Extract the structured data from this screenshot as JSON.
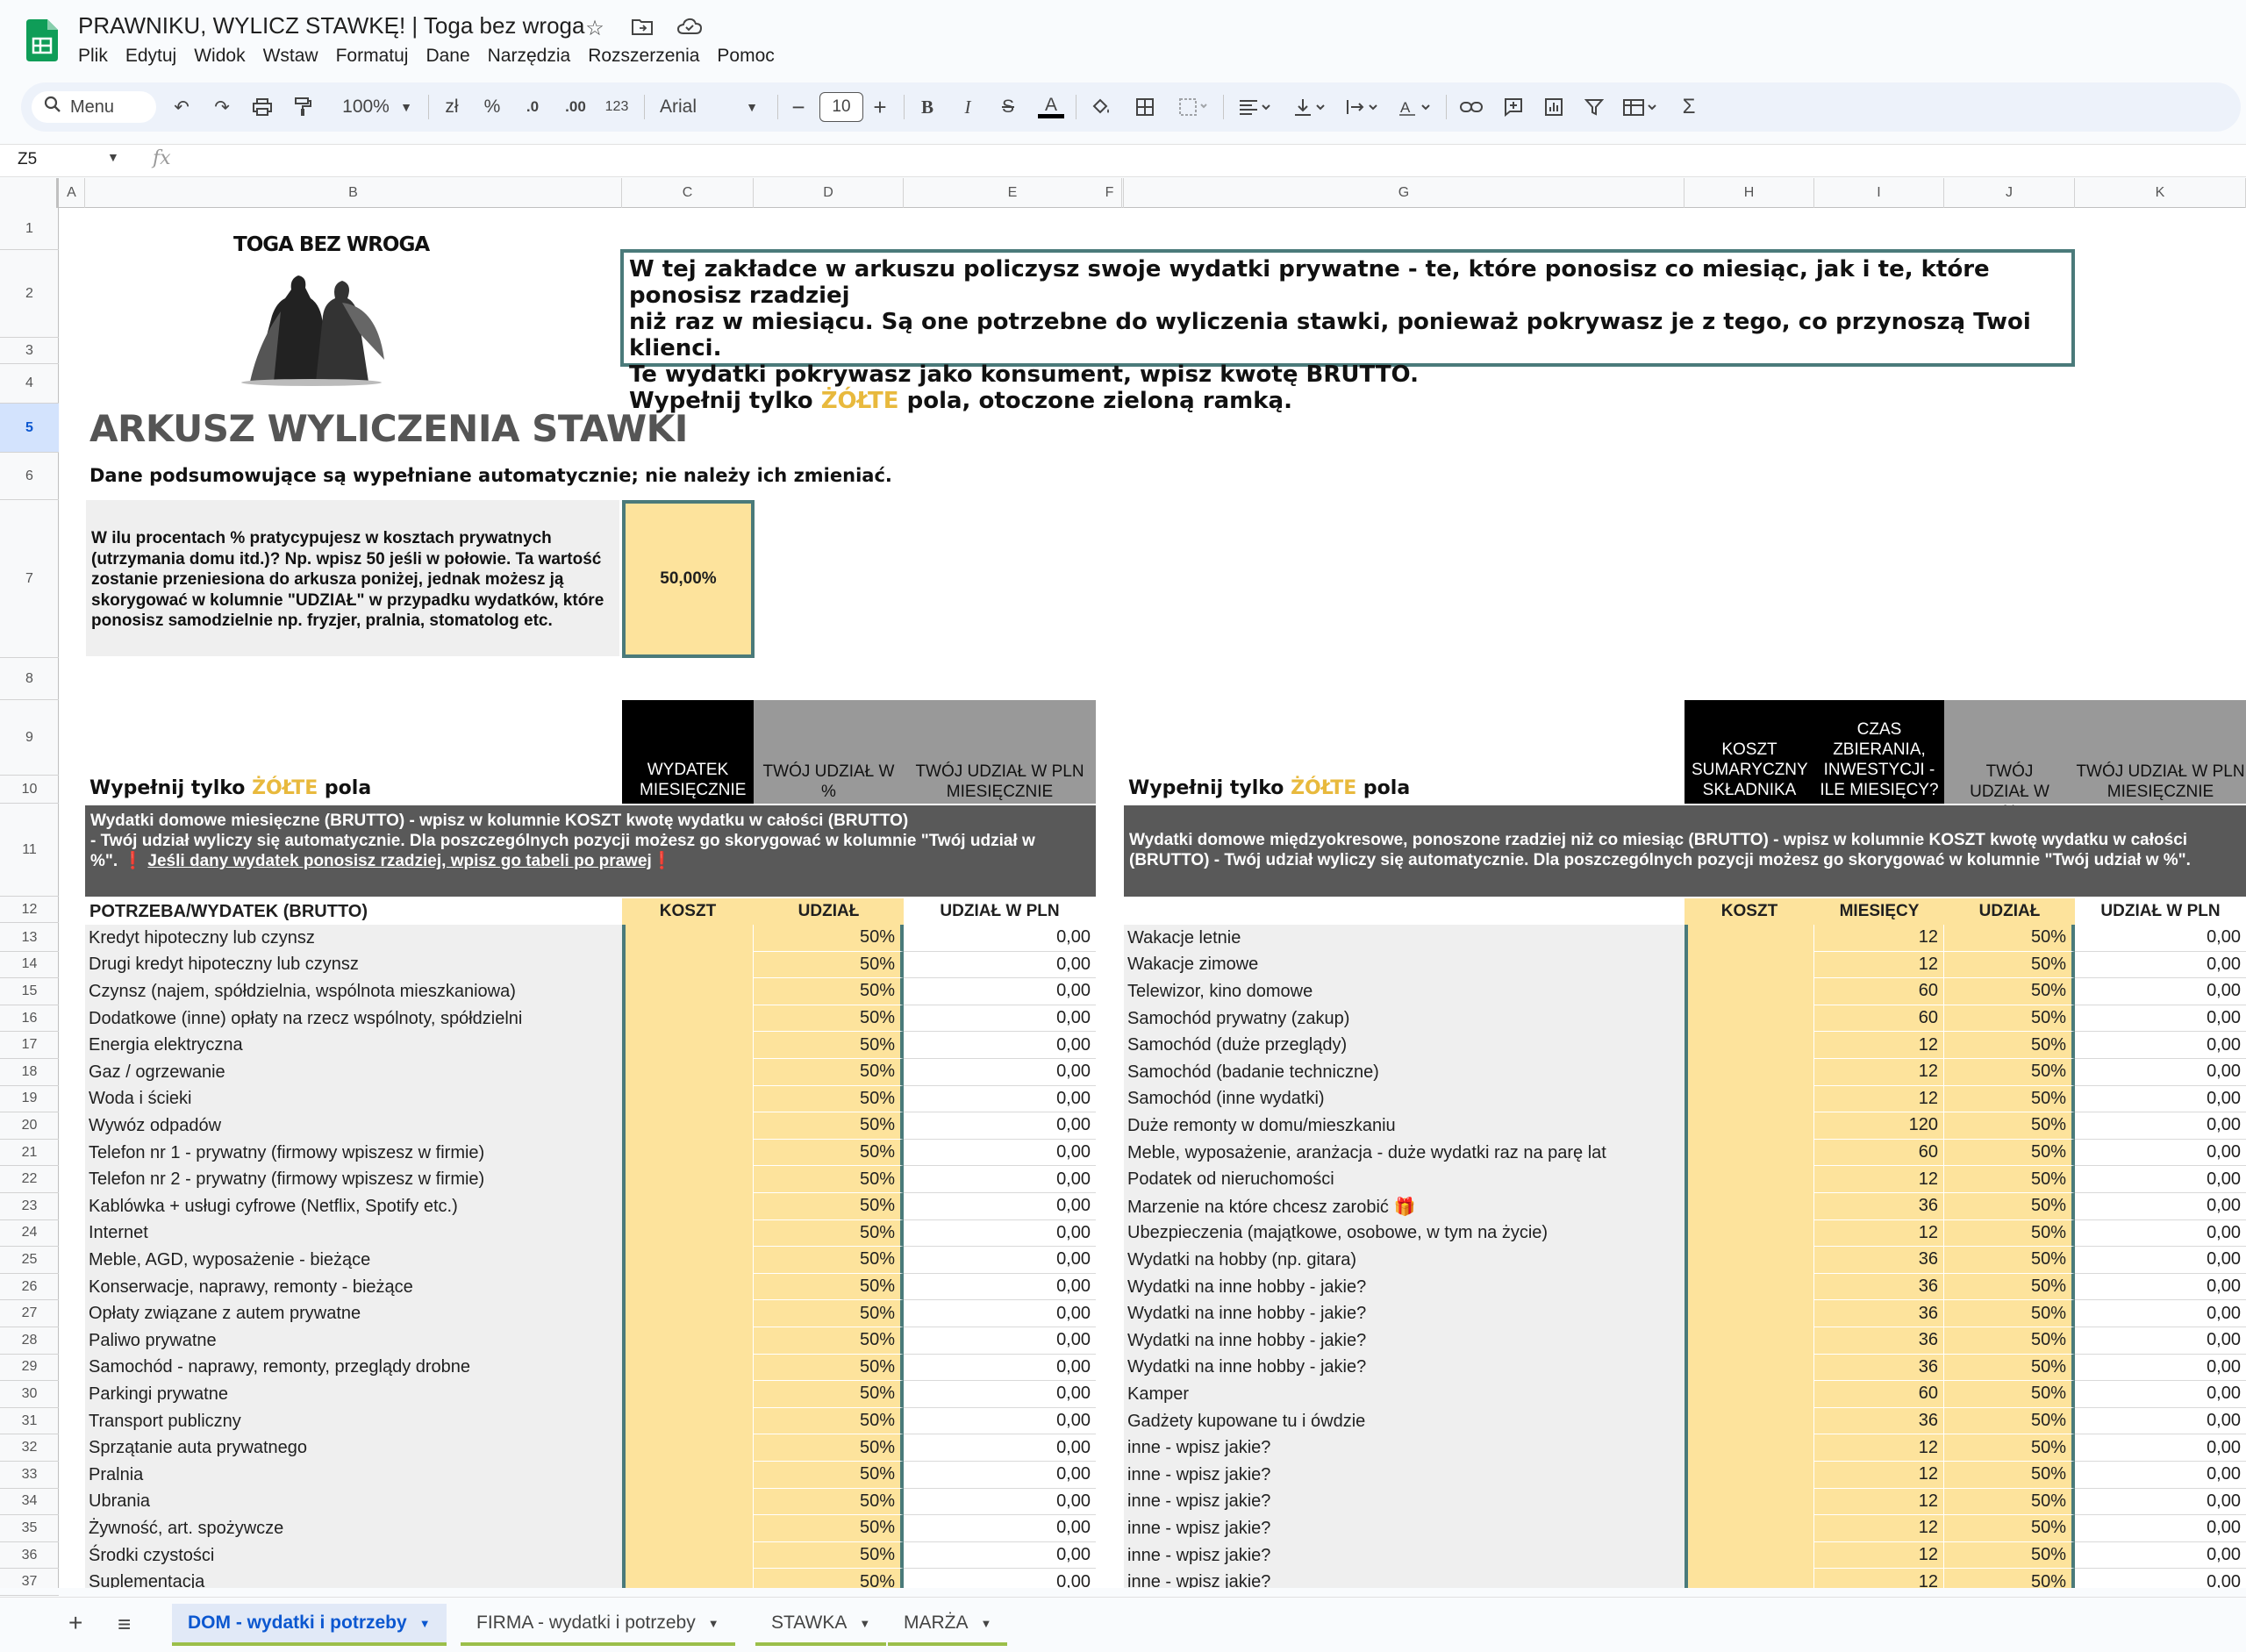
{
  "header": {
    "title": "PRAWNIKU, WYLICZ STAWKĘ! | Toga bez wroga",
    "menu": [
      "Plik",
      "Edytuj",
      "Widok",
      "Wstaw",
      "Formatuj",
      "Dane",
      "Narzędzia",
      "Rozszerzenia",
      "Pomoc"
    ]
  },
  "toolbar": {
    "menu_label": "Menu",
    "zoom": "100%",
    "currency": "zł",
    "percent": "%",
    "dec_decrease": ".0",
    "dec_increase": ".00",
    "format_123": "123",
    "font": "Arial",
    "font_size": "10"
  },
  "formula_bar": {
    "cell_ref": "Z5",
    "fx": "fx"
  },
  "columns": [
    "A",
    "B",
    "C",
    "D",
    "E",
    "F",
    "G",
    "H",
    "I",
    "J",
    "K"
  ],
  "rows": [
    "1",
    "2",
    "3",
    "4",
    "5",
    "6",
    "7",
    "8",
    "9",
    "10",
    "11",
    "12",
    "13",
    "14",
    "15",
    "16",
    "17",
    "18",
    "19",
    "20",
    "21",
    "22",
    "23",
    "24",
    "25",
    "26",
    "27",
    "28",
    "29",
    "30",
    "31",
    "32",
    "33",
    "34",
    "35",
    "36",
    "37"
  ],
  "sheet": {
    "logo_text": "TOGA BEZ WROGA",
    "info_line1": "W tej zakładce w arkuszu policzysz swoje wydatki prywatne - te, które ponosisz co miesiąc, jak i te, które ponosisz rzadziej",
    "info_line2": "niż raz w miesiącu. Są one potrzebne do wyliczenia stawki, ponieważ pokrywasz je z tego, co przynoszą Twoi klienci.",
    "info_line3": "Te wydatki pokrywasz jako konsument, wpisz kwotę BRUTTO.",
    "info_line4_pre": "Wypełnij tylko ",
    "info_line4_yellow": "ŻÓŁTE",
    "info_line4_post": " pola, otoczone zieloną ramką.",
    "title": "ARKUSZ WYLICZENIA STAWKI",
    "summary_note": "Dane podsumowujące są wypełniane automatycznie; nie należy ich zmieniać.",
    "question": "W ilu procentach % pratycypujesz w kosztach prywatnych (utrzymania domu itd.)? Np. wpisz 50 jeśli w połowie. Ta wartość zostanie przeniesiona do arkusza poniżej, jednak możesz ją skorygować w kolumnie \"UDZIAŁ\" w przypadku wydatków, które ponosisz samodzielnie np. fryzjer, pralnia, stomatolog etc.",
    "question_value": "50,00%",
    "fill_pre": "Wypełnij tylko ",
    "fill_yellow": "ŻÓŁTE",
    "fill_post": " pola"
  },
  "left_table": {
    "hdr_expense": "WYDATEK MIESIĘCZNIE",
    "hdr_share_pct": "TWÓJ UDZIAŁ W %",
    "hdr_share_pln": "TWÓJ UDZIAŁ W PLN MIESIĘCZNIE",
    "band_line1": "Wydatki domowe miesięczne (BRUTTO) - wpisz w kolumnie KOSZT kwotę wydatku w całości (BRUTTO)",
    "band_line2": "- Twój udział wyliczy się automatycznie. Dla poszczególnych pozycji możesz go skorygować w kolumnie \"Twój udział w",
    "band_line3_pre": "%\". ",
    "band_line3_link": "Jeśli dany wydatek ponosisz rzadziej, wpisz go tabeli po prawej",
    "col_name": "POTRZEBA/WYDATEK (BRUTTO)",
    "col_cost": "KOSZT",
    "col_share": "UDZIAŁ",
    "col_pln": "UDZIAŁ W PLN",
    "rows": [
      {
        "name": "Kredyt hipoteczny lub czynsz",
        "share": "50%",
        "pln": "0,00"
      },
      {
        "name": "Drugi kredyt hipoteczny lub czynsz",
        "share": "50%",
        "pln": "0,00"
      },
      {
        "name": "Czynsz (najem, spółdzielnia, wspólnota mieszkaniowa)",
        "share": "50%",
        "pln": "0,00"
      },
      {
        "name": "Dodatkowe (inne) opłaty na rzecz wspólnoty, spółdzielni",
        "share": "50%",
        "pln": "0,00"
      },
      {
        "name": "Energia elektryczna",
        "share": "50%",
        "pln": "0,00"
      },
      {
        "name": "Gaz / ogrzewanie",
        "share": "50%",
        "pln": "0,00"
      },
      {
        "name": "Woda i ścieki",
        "share": "50%",
        "pln": "0,00"
      },
      {
        "name": "Wywóz odpadów",
        "share": "50%",
        "pln": "0,00"
      },
      {
        "name": "Telefon nr 1 - prywatny (firmowy wpiszesz w firmie)",
        "share": "50%",
        "pln": "0,00"
      },
      {
        "name": "Telefon nr 2 - prywatny (firmowy wpiszesz w firmie)",
        "share": "50%",
        "pln": "0,00"
      },
      {
        "name": "Kablówka + usługi cyfrowe (Netflix, Spotify etc.)",
        "share": "50%",
        "pln": "0,00"
      },
      {
        "name": "Internet",
        "share": "50%",
        "pln": "0,00"
      },
      {
        "name": "Meble, AGD, wyposażenie - bieżące",
        "share": "50%",
        "pln": "0,00"
      },
      {
        "name": "Konserwacje, naprawy, remonty - bieżące",
        "share": "50%",
        "pln": "0,00"
      },
      {
        "name": "Opłaty związane z autem prywatne",
        "share": "50%",
        "pln": "0,00"
      },
      {
        "name": "Paliwo prywatne",
        "share": "50%",
        "pln": "0,00"
      },
      {
        "name": "Samochód - naprawy, remonty, przeglądy drobne",
        "share": "50%",
        "pln": "0,00"
      },
      {
        "name": "Parkingi prywatne",
        "share": "50%",
        "pln": "0,00"
      },
      {
        "name": "Transport publiczny",
        "share": "50%",
        "pln": "0,00"
      },
      {
        "name": "Sprzątanie auta prywatnego",
        "share": "50%",
        "pln": "0,00"
      },
      {
        "name": "Pralnia",
        "share": "50%",
        "pln": "0,00"
      },
      {
        "name": "Ubrania",
        "share": "50%",
        "pln": "0,00"
      },
      {
        "name": "Żywność, art. spożywcze",
        "share": "50%",
        "pln": "0,00"
      },
      {
        "name": "Środki czystości",
        "share": "50%",
        "pln": "0,00"
      },
      {
        "name": "Suplementacja",
        "share": "50%",
        "pln": "0,00"
      }
    ]
  },
  "right_table": {
    "hdr_cost": "KOSZT SUMARYCZNY SKŁADNIKA",
    "hdr_time": "CZAS ZBIERANIA, INWESTYCJI - ILE MIESIĘCY?",
    "hdr_share_pct": "TWÓJ UDZIAŁ W %",
    "hdr_share_pln": "TWÓJ UDZIAŁ W PLN MIESIĘCZNIE",
    "band_line1": "Wydatki domowe międzyokresowe, ponoszone rzadziej niż co miesiąc (BRUTTO) - wpisz w kolumnie KOSZT kwotę wydatku w całości",
    "band_line2": "(BRUTTO) - Twój udział wyliczy się automatycznie. Dla poszczególnych pozycji możesz go skorygować w kolumnie \"Twój udział w %\".",
    "col_cost": "KOSZT",
    "col_months": "MIESIĘCY",
    "col_share": "UDZIAŁ",
    "col_pln": "UDZIAŁ W PLN",
    "rows": [
      {
        "name": "Wakacje letnie",
        "months": "12",
        "share": "50%",
        "pln": "0,00"
      },
      {
        "name": "Wakacje zimowe",
        "months": "12",
        "share": "50%",
        "pln": "0,00"
      },
      {
        "name": "Telewizor, kino domowe",
        "months": "60",
        "share": "50%",
        "pln": "0,00"
      },
      {
        "name": "Samochód prywatny (zakup)",
        "months": "60",
        "share": "50%",
        "pln": "0,00"
      },
      {
        "name": "Samochód (duże przeglądy)",
        "months": "12",
        "share": "50%",
        "pln": "0,00"
      },
      {
        "name": "Samochód (badanie techniczne)",
        "months": "12",
        "share": "50%",
        "pln": "0,00"
      },
      {
        "name": "Samochód (inne wydatki)",
        "months": "12",
        "share": "50%",
        "pln": "0,00"
      },
      {
        "name": "Duże remonty w domu/mieszkaniu",
        "months": "120",
        "share": "50%",
        "pln": "0,00"
      },
      {
        "name": "Meble, wyposażenie, aranżacja - duże wydatki raz na parę lat",
        "months": "60",
        "share": "50%",
        "pln": "0,00"
      },
      {
        "name": "Podatek od nieruchomości",
        "months": "12",
        "share": "50%",
        "pln": "0,00"
      },
      {
        "name": "Marzenie na które chcesz zarobić 🎁",
        "months": "36",
        "share": "50%",
        "pln": "0,00"
      },
      {
        "name": "Ubezpieczenia (majątkowe, osobowe, w tym na życie)",
        "months": "12",
        "share": "50%",
        "pln": "0,00"
      },
      {
        "name": "Wydatki na hobby (np. gitara)",
        "months": "36",
        "share": "50%",
        "pln": "0,00"
      },
      {
        "name": "Wydatki na inne hobby - jakie?",
        "months": "36",
        "share": "50%",
        "pln": "0,00"
      },
      {
        "name": "Wydatki na inne hobby - jakie?",
        "months": "36",
        "share": "50%",
        "pln": "0,00"
      },
      {
        "name": "Wydatki na inne hobby - jakie?",
        "months": "36",
        "share": "50%",
        "pln": "0,00"
      },
      {
        "name": "Wydatki na inne hobby - jakie?",
        "months": "36",
        "share": "50%",
        "pln": "0,00"
      },
      {
        "name": "Kamper",
        "months": "60",
        "share": "50%",
        "pln": "0,00"
      },
      {
        "name": "Gadżety kupowane tu i ówdzie",
        "months": "36",
        "share": "50%",
        "pln": "0,00"
      },
      {
        "name": "inne - wpisz jakie?",
        "months": "12",
        "share": "50%",
        "pln": "0,00"
      },
      {
        "name": "inne - wpisz jakie?",
        "months": "12",
        "share": "50%",
        "pln": "0,00"
      },
      {
        "name": "inne - wpisz jakie?",
        "months": "12",
        "share": "50%",
        "pln": "0,00"
      },
      {
        "name": "inne - wpisz jakie?",
        "months": "12",
        "share": "50%",
        "pln": "0,00"
      },
      {
        "name": "inne - wpisz jakie?",
        "months": "12",
        "share": "50%",
        "pln": "0,00"
      },
      {
        "name": "inne - wpisz jakie?",
        "months": "12",
        "share": "50%",
        "pln": "0,00"
      }
    ]
  },
  "tabs": [
    {
      "label": "DOM - wydatki i potrzeby"
    },
    {
      "label": "FIRMA - wydatki i potrzeby"
    },
    {
      "label": "STAWKA"
    },
    {
      "label": "MARŻA"
    }
  ],
  "colors": {
    "accent": "#0b57d0",
    "yellow_fill": "#fde39c",
    "frame": "#4a7a7a",
    "band": "#595959"
  }
}
